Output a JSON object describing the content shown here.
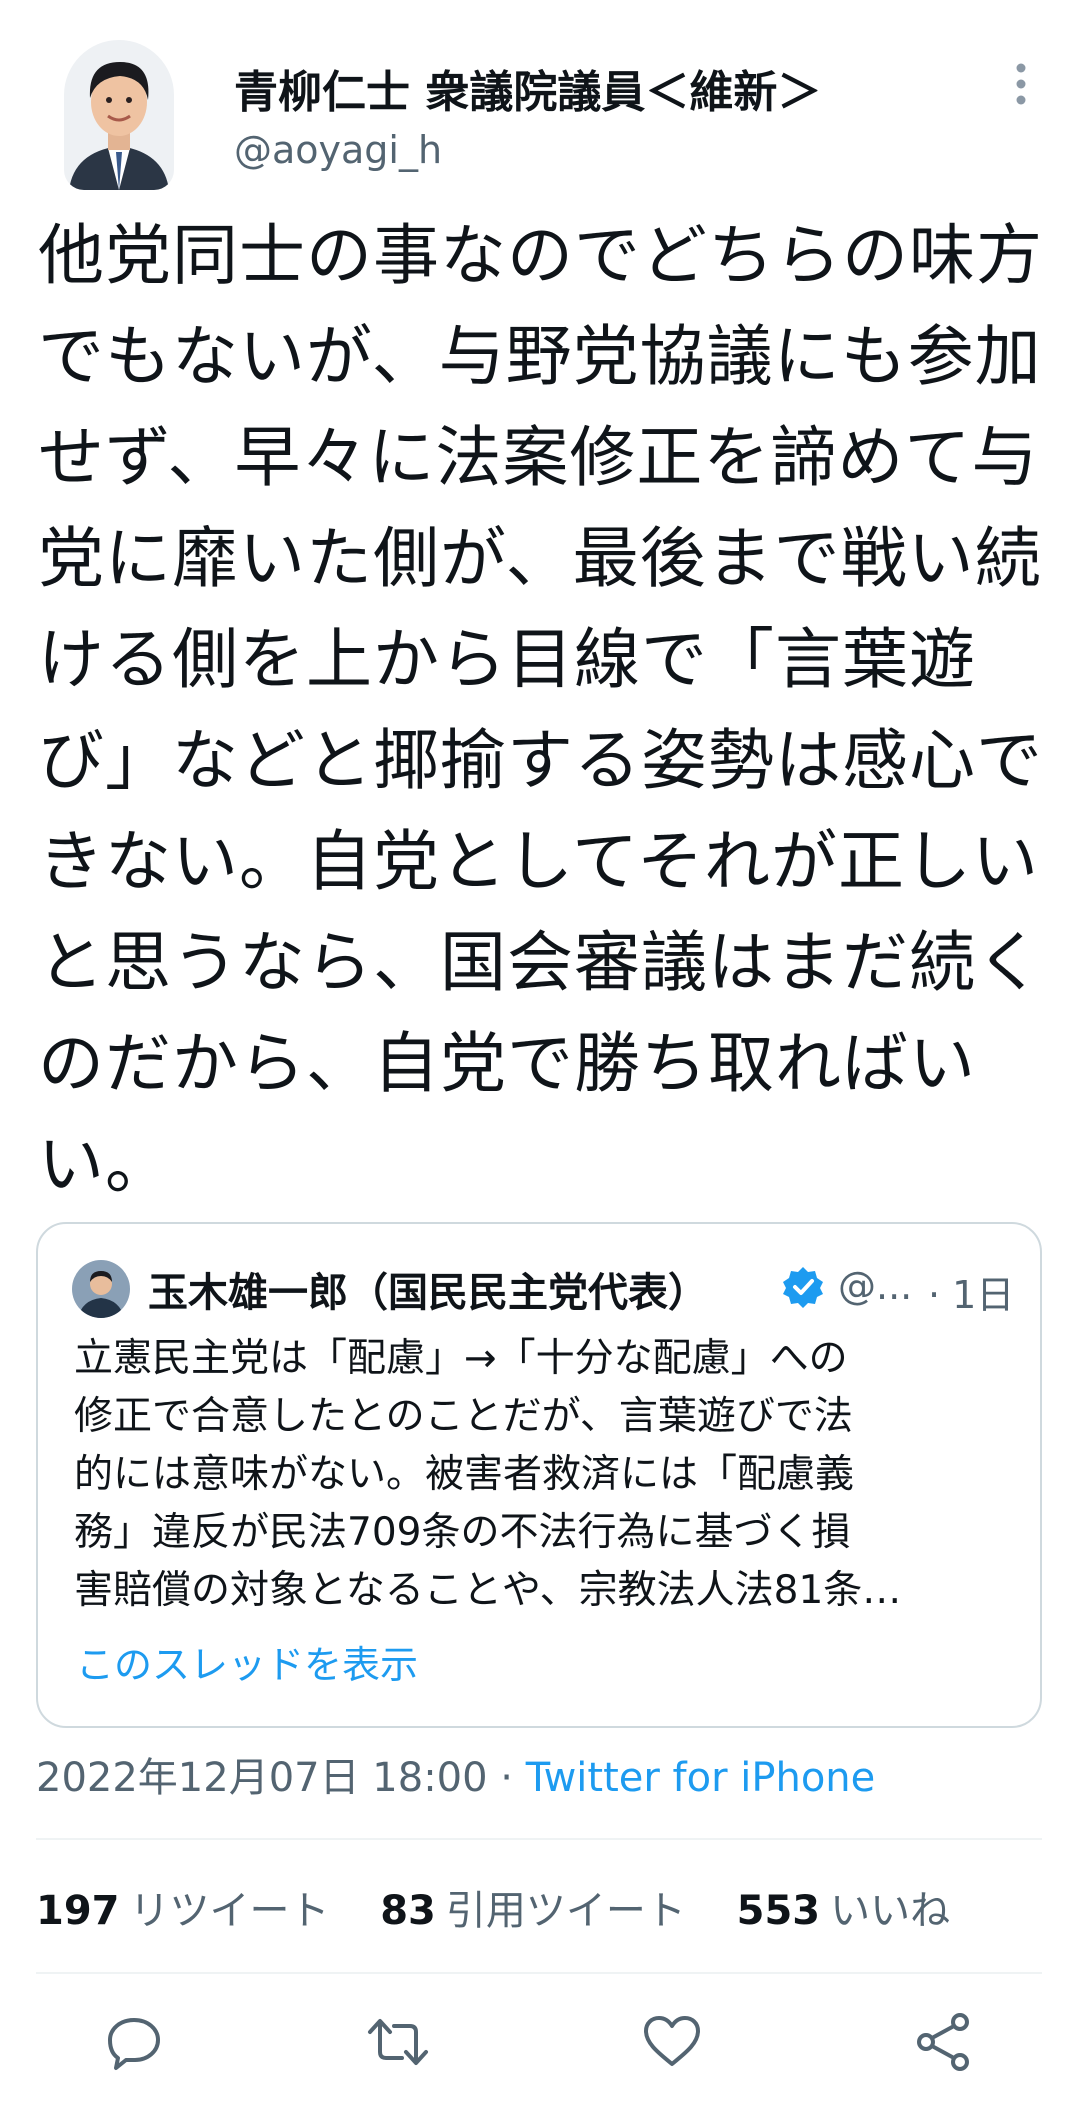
{
  "author": {
    "display_name": "青柳仁士 衆議院議員＜維新＞",
    "handle": "@aoyagi_h"
  },
  "tweet": {
    "lines": [
      "他党同士の事なのでどちらの味方",
      "でもないが、与野党協議にも参加",
      "せず、早々に法案修正を諦めて与",
      "党に靡いた側が、最後まで戦い続",
      "ける側を上から目線で「言葉遊",
      "び」などと揶揄する姿勢は感心で",
      "きない。自党としてそれが正しい",
      "と思うなら、国会審議はまだ続く",
      "のだから、自党で勝ち取ればい",
      "い。"
    ]
  },
  "quoted_tweet": {
    "name": "玉木雄一郎（国民民主党代表）",
    "handle": "@...",
    "time": "· 1日",
    "lines": [
      "立憲民主党は「配慮」→「十分な配慮」への",
      "修正で合意したとのことだが、言葉遊びで法",
      "的には意味がない。被害者救済には「配慮義",
      "務」違反が民法709条の不法行為に基づく損",
      "害賠償の対象となることや、宗教法人法81条…"
    ],
    "thread_link": "このスレッドを表示"
  },
  "meta": {
    "timestamp": "2022年12月07日 18:00",
    "separator": " · ",
    "source": "Twitter for iPhone"
  },
  "stats": {
    "retweets_count": "197",
    "retweets_label": "リツイート",
    "quotes_count": "83",
    "quotes_label": "引用ツイート",
    "likes_count": "553",
    "likes_label": "いいね"
  },
  "icons": {
    "more": "more-vertical-icon",
    "verified": "verified-badge-icon",
    "reply": "reply-icon",
    "retweet": "retweet-icon",
    "like": "heart-icon",
    "share": "share-icon"
  },
  "colors": {
    "accent": "#1d9bf0",
    "text": "#0f1419",
    "secondary": "#536471",
    "border": "#cfd9de"
  }
}
